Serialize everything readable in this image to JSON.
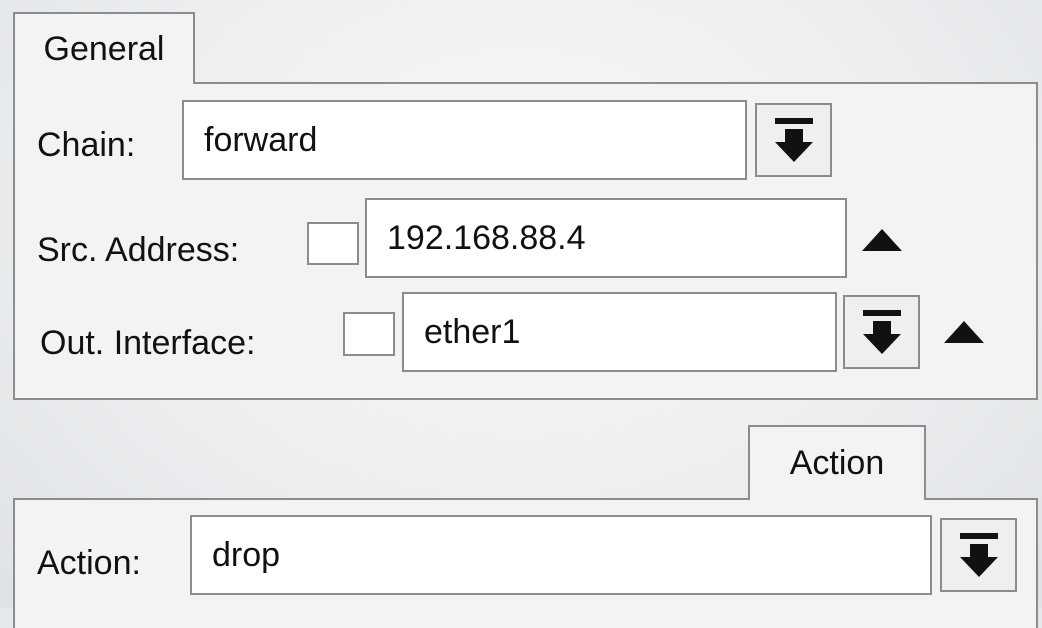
{
  "general": {
    "tab_label": "General",
    "chain": {
      "label": "Chain:",
      "value": "forward"
    },
    "src_address": {
      "label": "Src. Address:",
      "value": "192.168.88.4"
    },
    "out_interface": {
      "label": "Out. Interface:",
      "value": "ether1"
    }
  },
  "action": {
    "tab_label": "Action",
    "action": {
      "label": "Action:",
      "value": "drop"
    }
  },
  "icons": {
    "dropdown": "dropdown-arrow-icon",
    "collapse": "collapse-triangle-icon"
  }
}
